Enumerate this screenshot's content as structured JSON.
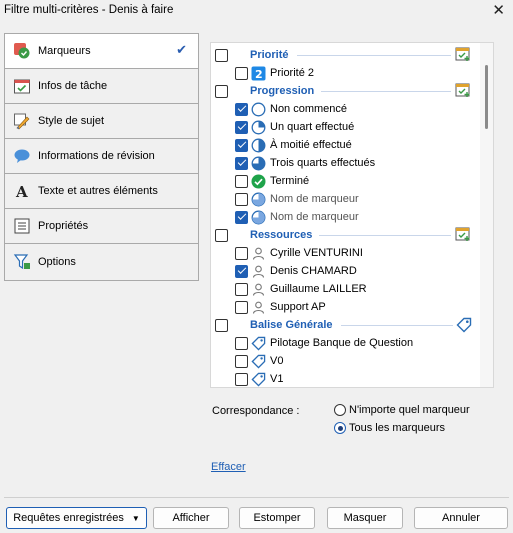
{
  "window": {
    "title": "Filtre multi-critères - Denis à faire",
    "close_glyph": "✕"
  },
  "nav": {
    "items": [
      {
        "label": "Marqueurs",
        "icon": "markers-icon",
        "active": true,
        "checked": true
      },
      {
        "label": "Infos de tâche",
        "icon": "task-info-icon"
      },
      {
        "label": "Style de sujet",
        "icon": "topic-style-icon"
      },
      {
        "label": "Informations de révision",
        "icon": "review-bubble-icon"
      },
      {
        "label": "Texte et autres éléments",
        "icon": "text-a-icon"
      },
      {
        "label": "Propriétés",
        "icon": "properties-list-icon"
      },
      {
        "label": "Options",
        "icon": "funnel-options-icon"
      }
    ],
    "check_glyph": "✔"
  },
  "markers": {
    "groups": [
      {
        "label": "Priorité",
        "checked": false,
        "icon": "calendar-add-icon",
        "items": [
          {
            "label": "Priorité 2",
            "checked": false,
            "icon": "priority-2-icon"
          }
        ]
      },
      {
        "label": "Progression",
        "checked": false,
        "icon": "calendar-add-icon",
        "items": [
          {
            "label": "Non commencé",
            "checked": true,
            "icon": "progress-0-icon"
          },
          {
            "label": "Un quart effectué",
            "checked": true,
            "icon": "progress-25-icon"
          },
          {
            "label": "À moitié effectué",
            "checked": true,
            "icon": "progress-50-icon"
          },
          {
            "label": "Trois quarts effectués",
            "checked": true,
            "icon": "progress-75-icon"
          },
          {
            "label": "Terminé",
            "checked": false,
            "icon": "done-check-icon"
          },
          {
            "label": "Nom de marqueur",
            "checked": false,
            "icon": "custom-marker-icon",
            "muted": true
          },
          {
            "label": "Nom de marqueur",
            "checked": true,
            "icon": "custom-marker-icon",
            "muted": true
          }
        ]
      },
      {
        "label": "Ressources",
        "checked": false,
        "icon": "calendar-add-icon",
        "items": [
          {
            "label": "Cyrille VENTURINI",
            "checked": false,
            "icon": "person-icon"
          },
          {
            "label": "Denis CHAMARD",
            "checked": true,
            "icon": "person-icon"
          },
          {
            "label": "Guillaume LAILLER",
            "checked": false,
            "icon": "person-icon"
          },
          {
            "label": "Support AP",
            "checked": false,
            "icon": "person-icon"
          }
        ]
      },
      {
        "label": "Balise Générale",
        "checked": false,
        "icon": "tag-icon",
        "items": [
          {
            "label": "Pilotage Banque de Question",
            "checked": false,
            "icon": "tag-icon"
          },
          {
            "label": "V0",
            "checked": false,
            "icon": "tag-icon"
          },
          {
            "label": "V1",
            "checked": false,
            "icon": "tag-icon"
          }
        ]
      }
    ]
  },
  "correspondance": {
    "label": "Correspondance :",
    "options": [
      {
        "label": "N'importe quel marqueur",
        "selected": false
      },
      {
        "label": "Tous les marqueurs",
        "selected": true
      }
    ]
  },
  "effacer_label": "Effacer",
  "footer": {
    "saved_queries_label": "Requêtes enregistrées",
    "show_label": "Afficher",
    "blur_label": "Estomper",
    "hide_label": "Masquer",
    "cancel_label": "Annuler"
  },
  "colors": {
    "accent": "#1f5fb4",
    "group_text": "#1f5fb4",
    "done_green": "#1ea34a",
    "priority_blue": "#1e88e5"
  }
}
